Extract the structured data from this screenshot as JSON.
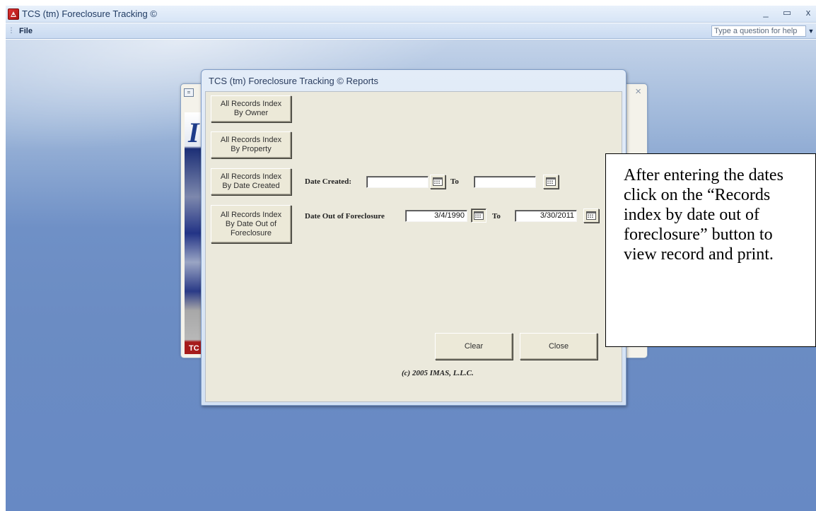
{
  "window": {
    "title": "TCS (tm) Foreclosure Tracking ©",
    "controls": [
      "_",
      "▭",
      "x"
    ]
  },
  "menubar": {
    "file": "File",
    "help_placeholder": "Type a question for help"
  },
  "dialog": {
    "title": "TCS (tm) Foreclosure Tracking ©  Reports",
    "buttons": {
      "by_owner": "All Records Index\nBy Owner",
      "by_property": "All Records Index\nBy Property",
      "by_date_created": "All Records Index\nBy Date Created",
      "by_date_out": "All Records Index\nBy Date Out of\nForeclosure",
      "clear": "Clear",
      "close": "Close"
    },
    "date_created": {
      "label": "Date Created:",
      "to_label": "To",
      "from_value": "",
      "to_value": ""
    },
    "date_out": {
      "label": "Date Out of Foreclosure",
      "to_label": "To",
      "from_value": "3/4/1990",
      "to_value": "3/30/2011"
    },
    "copyright": "(c) 2005 IMAS, L.L.C."
  },
  "splash": {
    "letter": "I",
    "badge": "TC"
  },
  "callout": {
    "text": "After entering the dates click on the “Records index by date out of foreclosure” button to view record and print."
  },
  "icons": {
    "app": "access-app-icon",
    "calendar": "calendar-icon"
  }
}
